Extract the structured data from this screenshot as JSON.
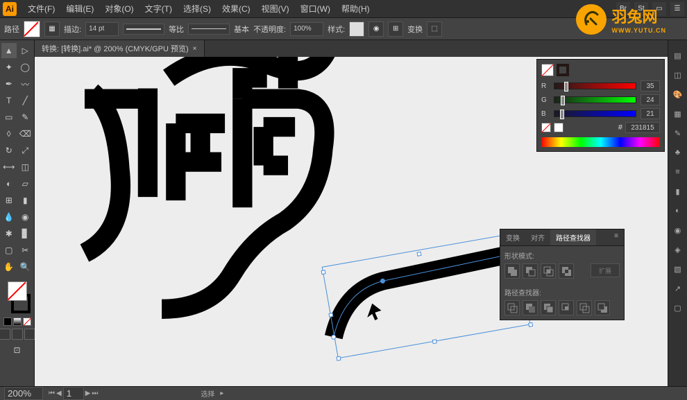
{
  "menubar": {
    "app": "Ai",
    "items": [
      "文件(F)",
      "编辑(E)",
      "对象(O)",
      "文字(T)",
      "选择(S)",
      "效果(C)",
      "视图(V)",
      "窗口(W)",
      "帮助(H)"
    ],
    "right_icons": [
      "Br",
      "St",
      "▭",
      "☰"
    ]
  },
  "optionsbar": {
    "tool_name": "路径",
    "stroke_label": "描边:",
    "stroke_weight": "14 pt",
    "uniform_label": "等比",
    "profile_label": "基本",
    "opacity_label": "不透明度:",
    "opacity_value": "100%",
    "style_label": "样式:",
    "transform_label": "变换"
  },
  "tab": {
    "title": "转换: [转换].ai* @ 200% (CMYK/GPU 预览)"
  },
  "color_panel": {
    "channels": [
      {
        "label": "R",
        "value": "35",
        "pos": 12
      },
      {
        "label": "G",
        "value": "24",
        "pos": 8
      },
      {
        "label": "B",
        "value": "21",
        "pos": 7
      }
    ],
    "hex": "231815"
  },
  "pathfinder": {
    "tabs": [
      "变换",
      "对齐",
      "路径查找器"
    ],
    "shape_modes_label": "形状模式:",
    "expand_label": "扩展",
    "pathfinders_label": "路径查找器:"
  },
  "statusbar": {
    "zoom": "200%",
    "page": "1",
    "tool_status": "选择"
  },
  "watermark": {
    "brand": "羽兔网",
    "url": "WWW.YUTU.CN"
  }
}
